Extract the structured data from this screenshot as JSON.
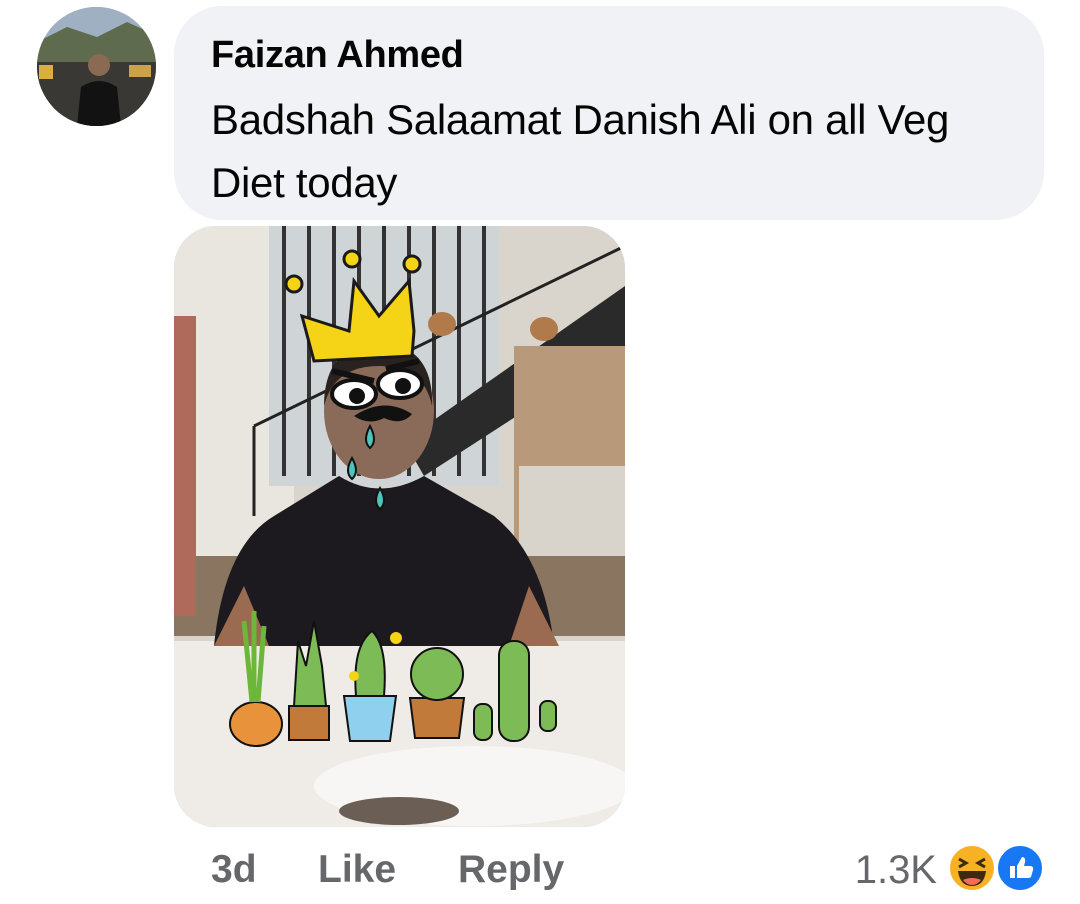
{
  "comment": {
    "author": "Faizan Ahmed",
    "text": "Badshah Salaamat Danish Ali on all Veg Diet today",
    "time": "3d",
    "like_label": "Like",
    "reply_label": "Reply",
    "reaction_count": "1.3K",
    "reactions": [
      "haha-icon",
      "like-icon"
    ]
  },
  "colors": {
    "bubble": "#f0f2f5",
    "secondary_text": "#65676b",
    "like_blue": "#1877f2",
    "haha_yellow": "#f7b125"
  }
}
